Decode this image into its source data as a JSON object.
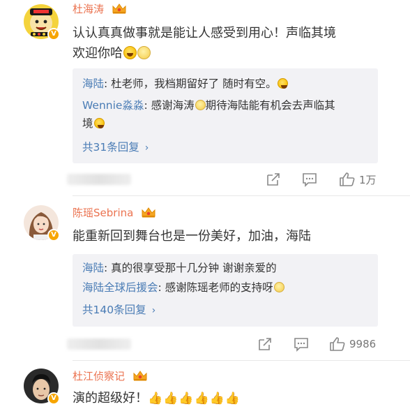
{
  "comments": [
    {
      "username": "杜海涛",
      "content_line1": "认认真真做事就是能让人感受到用心！声临其境",
      "content_line2": "欢迎你哈",
      "replies": [
        {
          "name": "海陆",
          "text": ": 杜老师，我档期留好了 随时有空。"
        },
        {
          "name": "Wennie淼淼",
          "text": ": 感谢海涛",
          "text2": "期待海陆能有机会去声临其",
          "text3": "境"
        }
      ],
      "more_replies": "共31条回复",
      "like_count": "1万"
    },
    {
      "username": "陈瑶Sebrina",
      "content": "能重新回到舞台也是一份美好，加油，海陆",
      "replies": [
        {
          "name": "海陆",
          "text": ": 真的很享受那十几分钟 谢谢亲爱的"
        },
        {
          "name": "海陆全球后援会",
          "text": ": 感谢陈瑶老师的支持呀"
        }
      ],
      "more_replies": "共140条回复",
      "like_count": "9986"
    },
    {
      "username": "杜江侦察记",
      "content": "演的超级好！"
    }
  ],
  "verified_badge": "V",
  "chevron": "›",
  "colors": {
    "username": "#eb7350",
    "reply_name": "#4a7cb5",
    "reply_bg": "#f2f2f5",
    "badge": "#f7a500"
  },
  "icons": [
    "crown-icon",
    "verified-icon",
    "share-icon",
    "comment-icon",
    "like-icon",
    "grin-emoji",
    "smile-emoji",
    "thumbs-up-emoji"
  ]
}
